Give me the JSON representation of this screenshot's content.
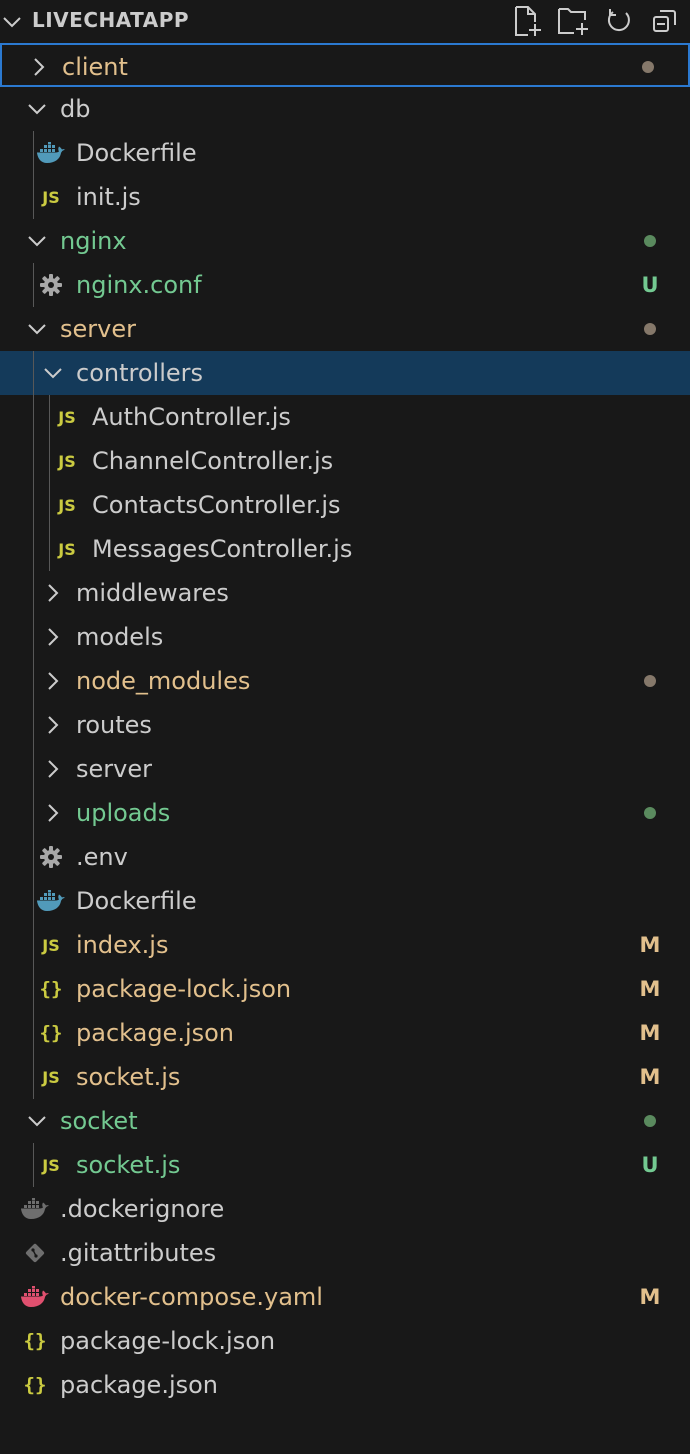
{
  "header": {
    "title": "LIVECHATAPP",
    "actions": [
      {
        "name": "new-file-icon"
      },
      {
        "name": "new-folder-icon"
      },
      {
        "name": "refresh-icon"
      },
      {
        "name": "collapse-all-icon"
      }
    ]
  },
  "colors": {
    "modified": "#e2c08d",
    "untracked": "#73c991",
    "selection": "#143a5a",
    "focus_border": "#2b79d0",
    "js_icon": "#cbcb41",
    "docker_icon": "#519aba",
    "docker_modified_icon": "#e0506f"
  },
  "tree": [
    {
      "label": "client",
      "type": "folder",
      "expanded": false,
      "color": "yellow",
      "dot": "olive",
      "focused": true
    },
    {
      "label": "db",
      "type": "folder",
      "expanded": true,
      "color": "default"
    },
    {
      "label": "Dockerfile",
      "type": "docker",
      "color": "default"
    },
    {
      "label": "init.js",
      "type": "js",
      "color": "default"
    },
    {
      "label": "nginx",
      "type": "folder",
      "expanded": true,
      "color": "green",
      "dot": "green"
    },
    {
      "label": "nginx.conf",
      "type": "gear",
      "color": "green",
      "badge": "U"
    },
    {
      "label": "server",
      "type": "folder",
      "expanded": true,
      "color": "yellow",
      "dot": "olive"
    },
    {
      "label": "controllers",
      "type": "folder",
      "expanded": true,
      "color": "default",
      "selected": true
    },
    {
      "label": "AuthController.js",
      "type": "js",
      "color": "default"
    },
    {
      "label": "ChannelController.js",
      "type": "js",
      "color": "default"
    },
    {
      "label": "ContactsController.js",
      "type": "js",
      "color": "default"
    },
    {
      "label": "MessagesController.js",
      "type": "js",
      "color": "default"
    },
    {
      "label": "middlewares",
      "type": "folder",
      "expanded": false,
      "color": "default"
    },
    {
      "label": "models",
      "type": "folder",
      "expanded": false,
      "color": "default"
    },
    {
      "label": "node_modules",
      "type": "folder",
      "expanded": false,
      "color": "yellow",
      "dot": "olive"
    },
    {
      "label": "routes",
      "type": "folder",
      "expanded": false,
      "color": "default"
    },
    {
      "label": "server",
      "type": "folder",
      "expanded": false,
      "color": "default"
    },
    {
      "label": "uploads",
      "type": "folder",
      "expanded": false,
      "color": "green",
      "dot": "green"
    },
    {
      "label": ".env",
      "type": "gear",
      "color": "default"
    },
    {
      "label": "Dockerfile",
      "type": "docker",
      "color": "default"
    },
    {
      "label": "index.js",
      "type": "js",
      "color": "yellow",
      "badge": "M"
    },
    {
      "label": "package-lock.json",
      "type": "json",
      "color": "yellow",
      "badge": "M"
    },
    {
      "label": "package.json",
      "type": "json",
      "color": "yellow",
      "badge": "M"
    },
    {
      "label": "socket.js",
      "type": "js",
      "color": "yellow",
      "badge": "M"
    },
    {
      "label": "socket",
      "type": "folder",
      "expanded": true,
      "color": "green",
      "dot": "green"
    },
    {
      "label": "socket.js",
      "type": "js",
      "color": "green",
      "badge": "U"
    },
    {
      "label": ".dockerignore",
      "type": "docker-gray",
      "color": "default"
    },
    {
      "label": ".gitattributes",
      "type": "git",
      "color": "default"
    },
    {
      "label": "docker-compose.yaml",
      "type": "docker-pink",
      "color": "yellow",
      "badge": "M"
    },
    {
      "label": "package-lock.json",
      "type": "json",
      "color": "default"
    },
    {
      "label": "package.json",
      "type": "json",
      "color": "default"
    }
  ]
}
